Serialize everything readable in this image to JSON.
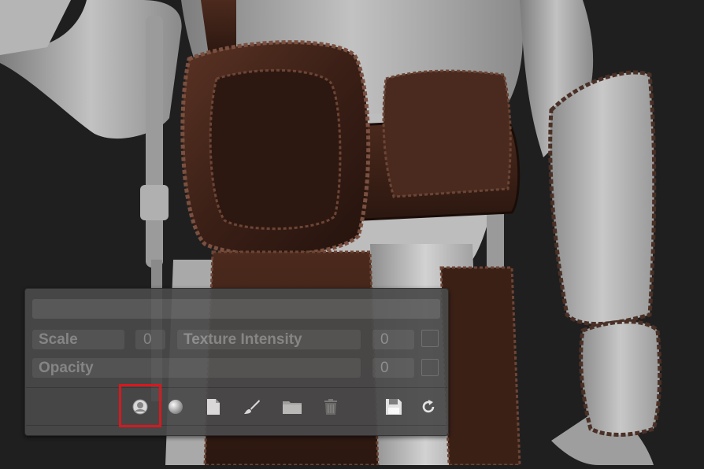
{
  "panel": {
    "title": "",
    "scale_label": "Scale",
    "scale_value": "0",
    "texture_intensity_label": "Texture Intensity",
    "texture_intensity_value": "0",
    "opacity_label": "Opacity",
    "opacity_value": "0"
  },
  "toolbar": {
    "icons": [
      "material-sphere-icon",
      "sphere-icon",
      "new-document-icon",
      "brush-icon",
      "folder-icon",
      "trash-icon",
      "save-icon",
      "refresh-icon"
    ]
  },
  "colors": {
    "highlight": "#d7191f",
    "leather": "#4a2a1e",
    "model_gray": "#a8a8a8"
  }
}
